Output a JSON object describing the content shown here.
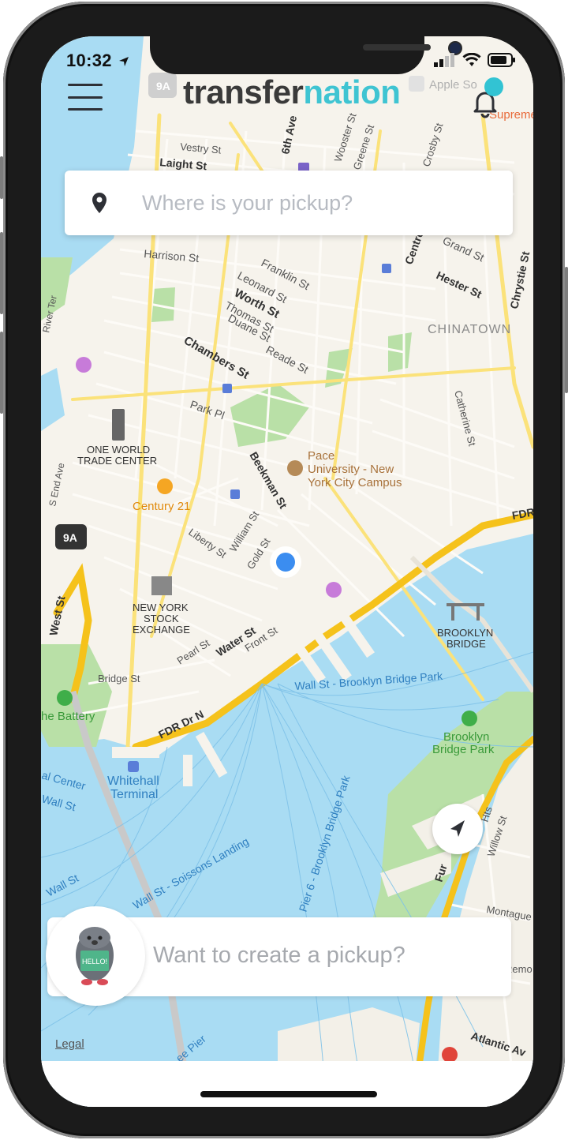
{
  "status_bar": {
    "time": "10:32",
    "location_icon": "location-arrow-icon",
    "signal_icon": "cellular-signal-icon",
    "wifi_icon": "wifi-icon",
    "battery_icon": "battery-icon"
  },
  "header": {
    "menu_icon": "hamburger-menu-icon",
    "logo_part1": "transfer",
    "logo_part2": "nation",
    "bell_icon": "bell-icon"
  },
  "search": {
    "placeholder": "Where is your pickup?",
    "icon": "map-pin-icon"
  },
  "map": {
    "streets": {
      "vestry": "Vestry St",
      "laight": "Laight St",
      "sixth_ave": "6th Ave",
      "wooster": "Wooster St",
      "greene": "Greene St",
      "crosby": "Crosby St",
      "grand": "Grand St",
      "hester": "Hester St",
      "chrystie": "Chrystie St",
      "centre": "Centre",
      "harrison": "Harrison St",
      "franklin": "Franklin St",
      "leonard": "Leonard St",
      "worth": "Worth St",
      "thomas": "Thomas St",
      "duane": "Duane St",
      "reade": "Reade St",
      "chambers": "Chambers St",
      "park_pl": "Park Pl",
      "river_ter": "River Ter",
      "s_end_ave": "S End Ave",
      "west_st": "West St",
      "beekman": "Beekman St",
      "william": "William St",
      "gold": "Gold St",
      "liberty": "Liberty St",
      "catherine": "Catherine St",
      "water": "Water St",
      "front": "Front St",
      "pearl": "Pearl St",
      "bridge": "Bridge St",
      "fdr_dr_n": "FDR Dr N",
      "fdr": "FDR",
      "willow": "Willow St",
      "hts": "Hts",
      "montague": "Montague",
      "remo": "Remo",
      "atlantic": "Atlantic Av",
      "fur": "Fur"
    },
    "places": {
      "apple_soho": "Apple So",
      "supreme": "Supreme",
      "chinatown": "CHINATOWN",
      "one_world_1": "ONE WORLD",
      "one_world_2": "TRADE CENTER",
      "century21": "Century 21",
      "pace_1": "Pace",
      "pace_2": "University - New",
      "pace_3": "York City Campus",
      "nyse_1": "NEW YORK",
      "nyse_2": "STOCK",
      "nyse_3": "EXCHANGE",
      "brooklyn_bridge_1": "BROOKLYN",
      "brooklyn_bridge_2": "BRIDGE",
      "bb_park_1": "Brooklyn",
      "bb_park_2": "Bridge Park",
      "battery": "he Battery",
      "whitehall_1": "Whitehall",
      "whitehall_2": "Terminal",
      "hwy_9a": "9A"
    },
    "water": {
      "ferry_bbp": "Wall St - Brooklyn Bridge Park",
      "ferry_pier6": "Pier 6 - Brooklyn Bridge Park",
      "ferry_soissons": "Wall St - Soissons Landing",
      "ferry_wall": "Wall St",
      "ferry_wall2": "Wall St",
      "ferry_center": "al Center",
      "pier": "ee Pier"
    }
  },
  "locate_icon": "navigation-arrow-icon",
  "pickup": {
    "prompt": "Want to create a pickup?",
    "mascot_icon": "mascot-hello-icon",
    "mascot_sign": "HELLO!"
  },
  "legal": "Legal"
}
